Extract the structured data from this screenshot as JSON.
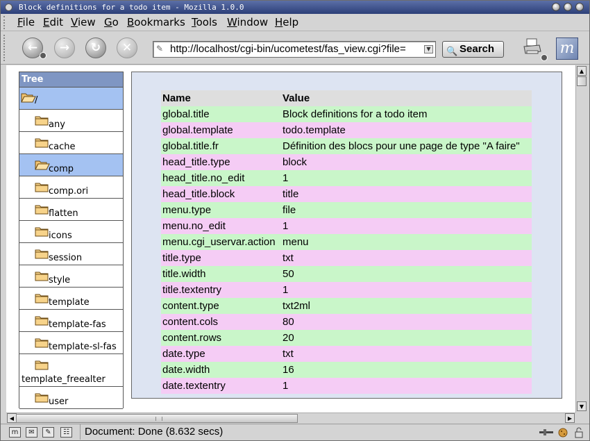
{
  "window": {
    "title": "Block definitions for a todo item - Mozilla 1.0.0"
  },
  "menubar": [
    {
      "pre": "",
      "ul": "F",
      "post": "ile"
    },
    {
      "pre": "",
      "ul": "E",
      "post": "dit"
    },
    {
      "pre": "",
      "ul": "V",
      "post": "iew"
    },
    {
      "pre": "",
      "ul": "G",
      "post": "o"
    },
    {
      "pre": "",
      "ul": "B",
      "post": "ookmarks"
    },
    {
      "pre": "",
      "ul": "T",
      "post": "ools"
    },
    {
      "pre": "",
      "ul": "W",
      "post": "indow"
    },
    {
      "pre": "",
      "ul": "H",
      "post": "elp"
    }
  ],
  "navbar": {
    "url": "http://localhost/cgi-bin/ucometest/fas_view.cgi?file=",
    "search_label": "Search"
  },
  "tree": {
    "header": "Tree",
    "items": [
      {
        "label": "/",
        "open": true,
        "selected": true
      },
      {
        "label": "any",
        "open": false,
        "selected": false
      },
      {
        "label": "cache",
        "open": false,
        "selected": false
      },
      {
        "label": "comp",
        "open": true,
        "selected": true
      },
      {
        "label": "comp.ori",
        "open": false,
        "selected": false
      },
      {
        "label": "flatten",
        "open": false,
        "selected": false
      },
      {
        "label": "icons",
        "open": false,
        "selected": false
      },
      {
        "label": "session",
        "open": false,
        "selected": false
      },
      {
        "label": "style",
        "open": false,
        "selected": false
      },
      {
        "label": "template",
        "open": false,
        "selected": false
      },
      {
        "label": "template-fas",
        "open": false,
        "selected": false
      },
      {
        "label": "template-sl-fas",
        "open": false,
        "selected": false
      },
      {
        "label": "template_freealter",
        "open": false,
        "selected": false
      },
      {
        "label": "user",
        "open": false,
        "selected": false
      }
    ]
  },
  "table": {
    "headers": [
      "Name",
      "Value"
    ],
    "rows": [
      [
        "global.title",
        "Block definitions for a todo item"
      ],
      [
        "global.template",
        "todo.template"
      ],
      [
        "global.title.fr",
        "Définition des blocs pour une page de type \"A faire\""
      ],
      [
        "head_title.type",
        "block"
      ],
      [
        "head_title.no_edit",
        "1"
      ],
      [
        "head_title.block",
        "title"
      ],
      [
        "menu.type",
        "file"
      ],
      [
        "menu.no_edit",
        "1"
      ],
      [
        "menu.cgi_uservar.action",
        "menu"
      ],
      [
        "title.type",
        "txt"
      ],
      [
        "title.width",
        "50"
      ],
      [
        "title.textentry",
        "1"
      ],
      [
        "content.type",
        "txt2ml"
      ],
      [
        "content.cols",
        "80"
      ],
      [
        "content.rows",
        "20"
      ],
      [
        "date.type",
        "txt"
      ],
      [
        "date.width",
        "16"
      ],
      [
        "date.textentry",
        "1"
      ]
    ]
  },
  "status": {
    "text": "Document: Done (8.632 secs)"
  },
  "colors": {
    "row_even": "#c9f6c9",
    "row_odd": "#f5ccf5",
    "tree_header": "#7f96c3",
    "selected": "#a4c2f2",
    "panel": "#dde4f2"
  }
}
